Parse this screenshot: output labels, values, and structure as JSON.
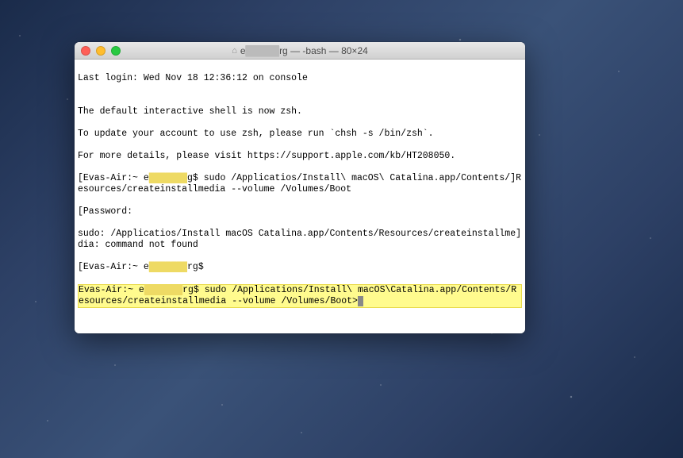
{
  "window": {
    "title_user_prefix": "e",
    "title_user_redacted": "█████",
    "title_suffix": "rg — -bash — 80×24"
  },
  "terminal": {
    "last_login": "Last login: Wed Nov 18 12:36:12 on console",
    "blank": "",
    "zsh_notice_1": "The default interactive shell is now zsh.",
    "zsh_notice_2": "To update your account to use zsh, please run `chsh -s /bin/zsh`.",
    "zsh_notice_3": "For more details, please visit https://support.apple.com/kb/HT208050.",
    "prompt1_pre": "[Evas-Air:~ e",
    "prompt1_redact": "███████",
    "prompt1_post": "g$ sudo /Applicatios/Install\\ macOS\\ Catalina.app/Contents/]Resources/createinstallmedia --volume /Volumes/Boot",
    "password": "[Password:",
    "sudo_error": "sudo: /Applicatios/Install macOS Catalina.app/Contents/Resources/createinstallme]dia: command not found",
    "prompt2_pre": "[Evas-Air:~ e",
    "prompt2_redact": "███████",
    "prompt2_post": "rg$",
    "prompt3_pre": "Evas-Air:~ e",
    "prompt3_redact": "███████",
    "prompt3_post": "rg$ sudo /Applications/Install\\ macOS\\Catalina.app/Contents/Resources/createinstallmedia --volume /Volumes/Boot>"
  }
}
